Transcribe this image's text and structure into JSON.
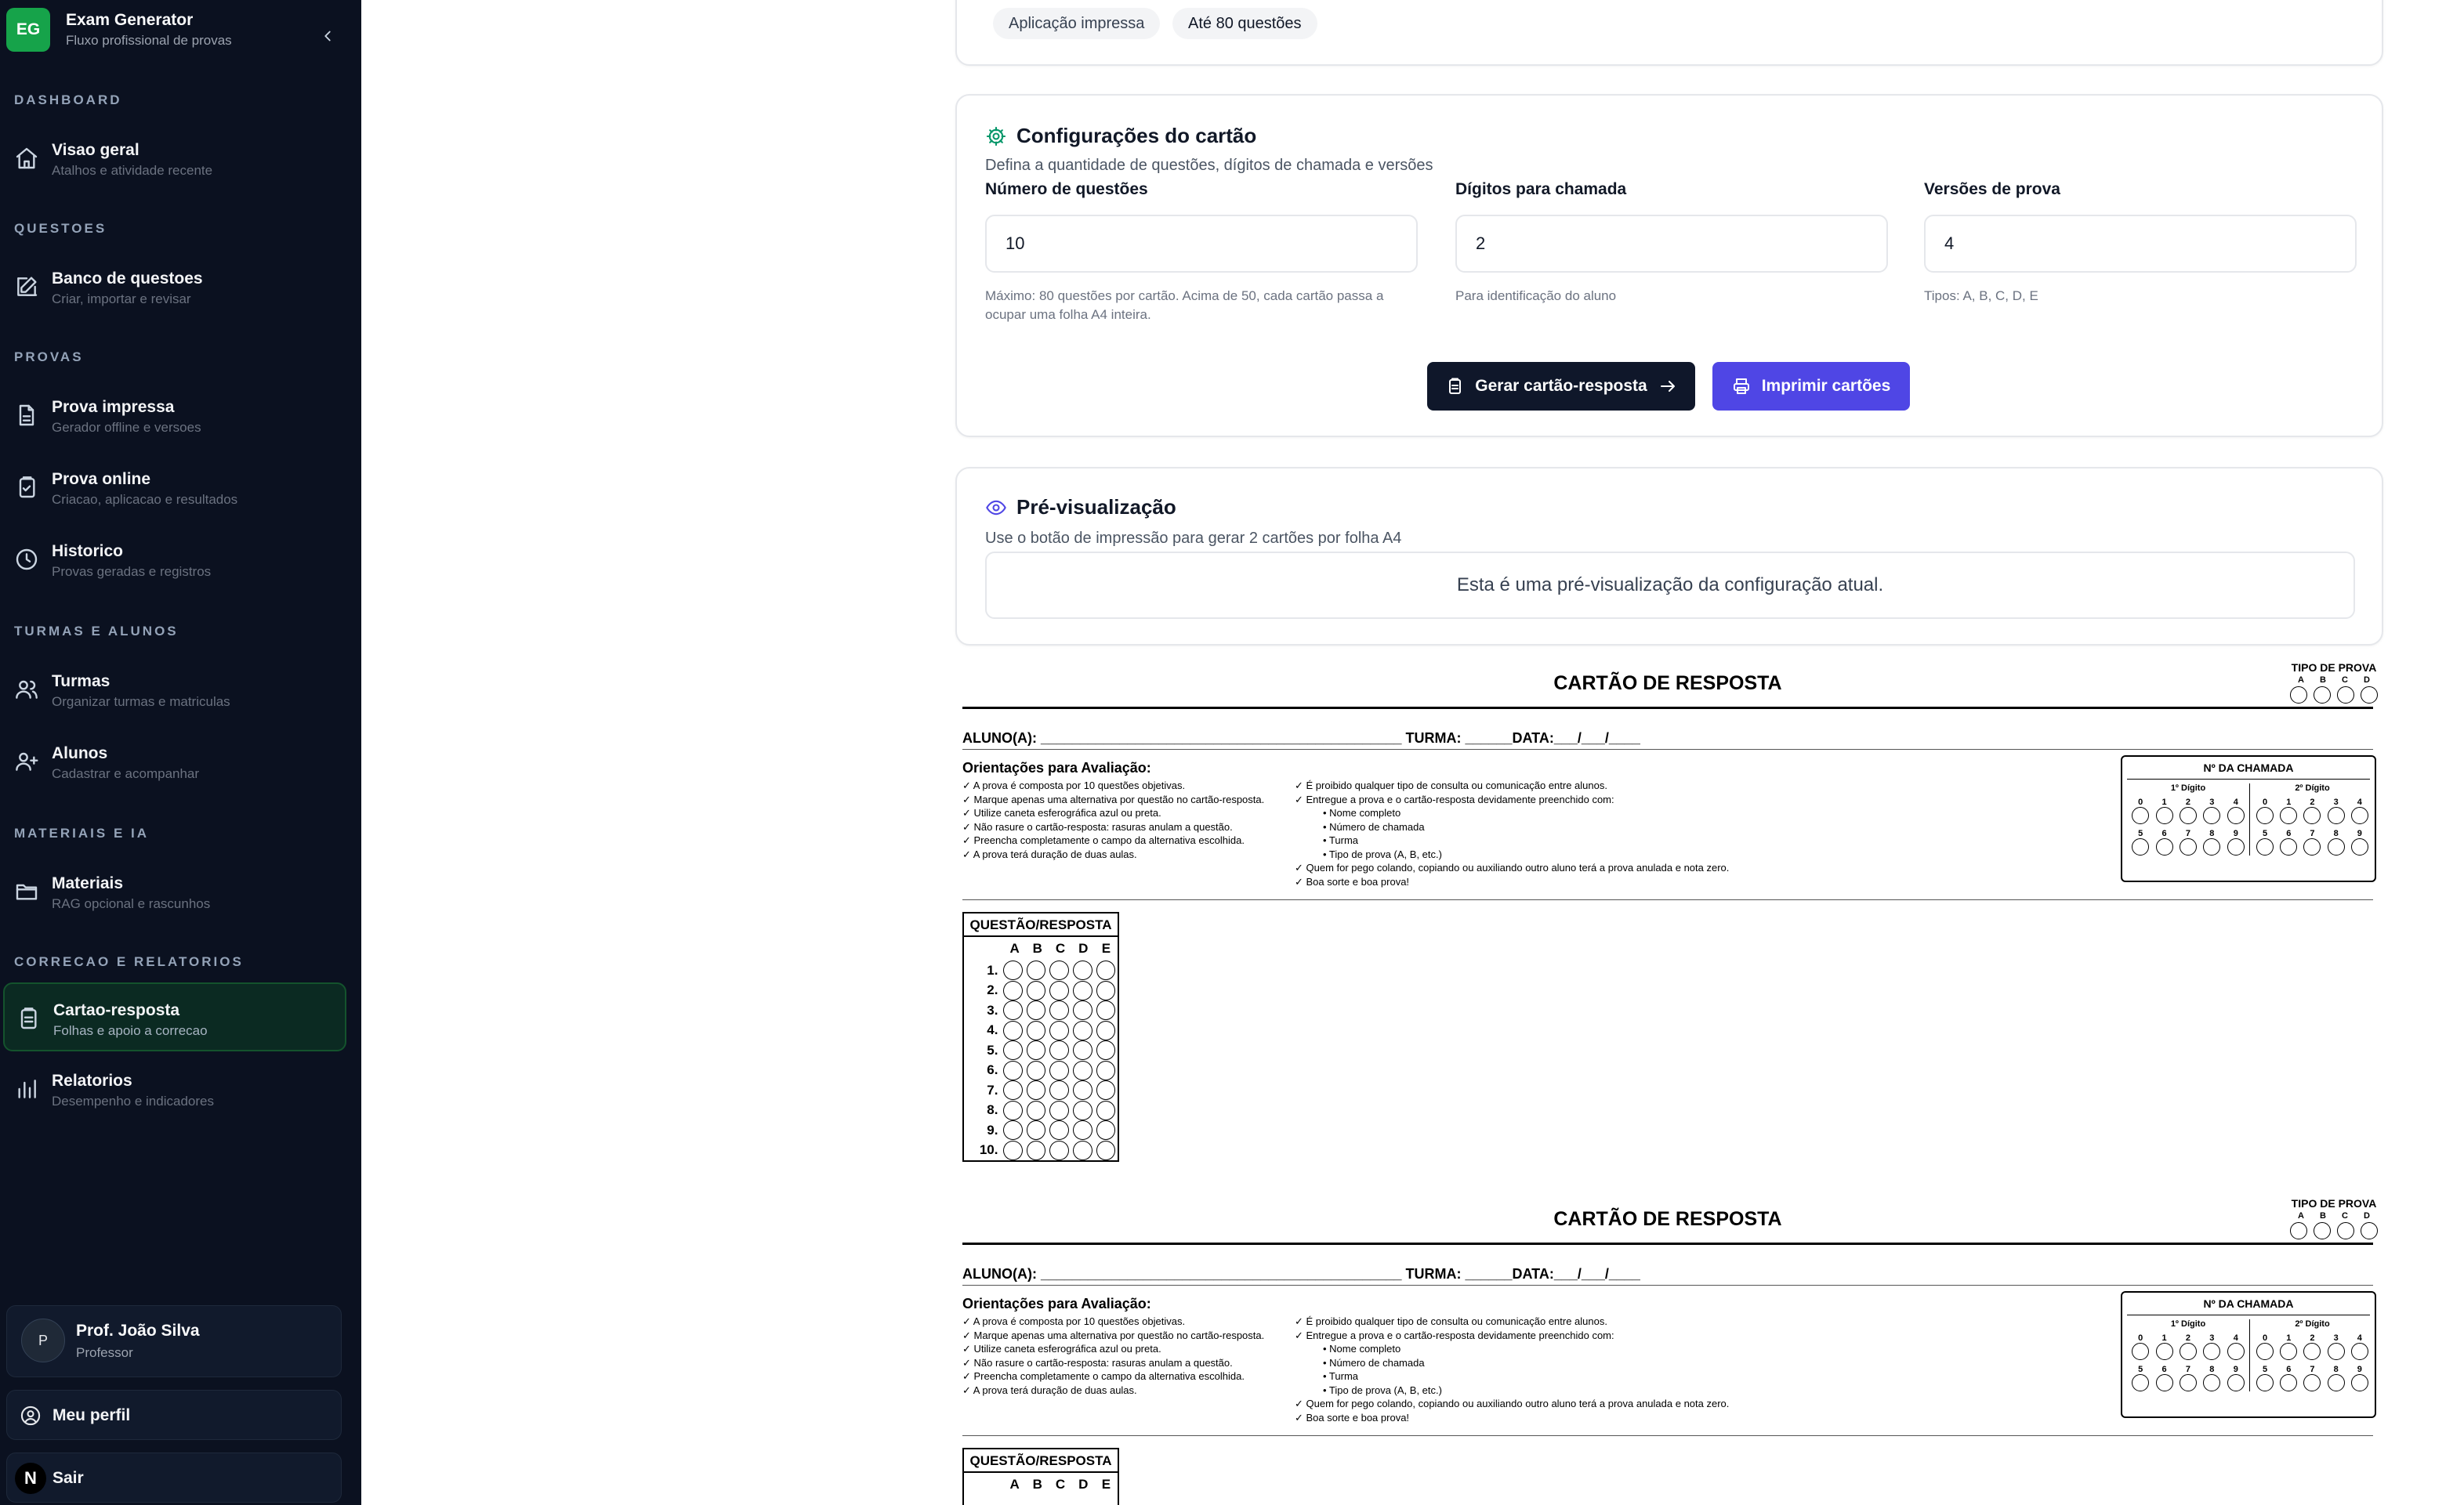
{
  "brand": {
    "initials": "EG",
    "title": "Exam Generator",
    "subtitle": "Fluxo profissional de provas"
  },
  "sidebar": {
    "sections": [
      "DASHBOARD",
      "QUESTOES",
      "PROVAS",
      "TURMAS E ALUNOS",
      "MATERIAIS E IA",
      "CORRECAO E RELATORIOS"
    ],
    "items": [
      {
        "label": "Visao geral",
        "sub": "Atalhos e atividade recente",
        "icon": "home-icon"
      },
      {
        "label": "Banco de questoes",
        "sub": "Criar, importar e revisar",
        "icon": "edit-icon"
      },
      {
        "label": "Prova impressa",
        "sub": "Gerador offline e versoes",
        "icon": "file-icon"
      },
      {
        "label": "Prova online",
        "sub": "Criacao, aplicacao e resultados",
        "icon": "clipboard-icon"
      },
      {
        "label": "Historico",
        "sub": "Provas geradas e registros",
        "icon": "clock-icon"
      },
      {
        "label": "Turmas",
        "sub": "Organizar turmas e matriculas",
        "icon": "users-icon"
      },
      {
        "label": "Alunos",
        "sub": "Cadastrar e acompanhar",
        "icon": "user-icon"
      },
      {
        "label": "Materiais",
        "sub": "RAG opcional e rascunhos",
        "icon": "folder-icon"
      },
      {
        "label": "Cartao-resposta",
        "sub": "Folhas e apoio a correcao",
        "icon": "clipboard-icon",
        "active": true
      },
      {
        "label": "Relatorios",
        "sub": "Desempenho e indicadores",
        "icon": "bar-chart-icon"
      }
    ],
    "user": {
      "initial": "P",
      "name": "Prof. João Silva",
      "role": "Professor"
    },
    "profile_label": "Meu perfil",
    "logout_label": "Sair",
    "logout_badge": "N"
  },
  "top_chips": [
    "Aplicação impressa",
    "Até 80 questões"
  ],
  "config": {
    "title": "Configurações do cartão",
    "description": "Defina a quantidade de questões, dígitos de chamada e versões",
    "fields": [
      {
        "label": "Número de questões",
        "value": "10",
        "hint": "Máximo: 80 questões por cartão. Acima de 50, cada cartão passa a ocupar uma folha A4 inteira."
      },
      {
        "label": "Dígitos para chamada",
        "value": "2",
        "hint": "Para identificação do aluno"
      },
      {
        "label": "Versões de prova",
        "value": "4",
        "hint": "Tipos: A, B, C, D, E"
      }
    ],
    "generate_label": "Gerar cartão-resposta",
    "print_label": "Imprimir cartões"
  },
  "preview": {
    "title": "Pré-visualização",
    "description": "Use o botão de impressão para gerar 2 cartões por folha A4",
    "note": "Esta é uma pré-visualização da configuração atual."
  },
  "sheet": {
    "title": "CARTÃO DE RESPOSTA",
    "tipo_title": "TIPO DE PROVA",
    "tipo_letters": [
      "A",
      "B",
      "C",
      "D"
    ],
    "aluno_line": "ALUNO(A): ______________________________________________ TURMA: ______DATA:___/___/____",
    "orient_title": "Orientações para Avaliação:",
    "orient_left": [
      "✓ A prova é composta por 10 questões objetivas.",
      "✓ Marque apenas uma alternativa por questão no cartão-resposta.",
      "✓ Utilize caneta esferográfica azul ou preta.",
      "✓ Não rasure o cartão-resposta: rasuras anulam a questão.",
      "✓ Preencha completamente o campo da alternativa escolhida.",
      "✓ A prova terá duração de duas aulas."
    ],
    "orient_right": [
      "✓ É proibido qualquer tipo de consulta ou comunicação entre alunos.",
      "✓ Entregue a prova e o cartão-resposta devidamente preenchido com:",
      "• Nome completo",
      "• Número de chamada",
      "• Turma",
      "• Tipo de prova (A, B, etc.)",
      "✓ Quem for pego colando, copiando ou auxiliando outro aluno terá a prova anulada e nota zero.",
      "✓ Boa sorte e boa prova!"
    ],
    "chamada_title": "Nº DA CHAMADA",
    "digit_titles": [
      "1º Dígito",
      "2º Dígito"
    ],
    "digits_row1": [
      "0",
      "1",
      "2",
      "3",
      "4"
    ],
    "digits_row2": [
      "5",
      "6",
      "7",
      "8",
      "9"
    ],
    "qr_title": "QUESTÃO/RESPOSTA",
    "qr_letters": [
      "A",
      "B",
      "C",
      "D",
      "E"
    ],
    "question_numbers": [
      "1.",
      "2.",
      "3.",
      "4.",
      "5.",
      "6.",
      "7.",
      "8.",
      "9.",
      "10."
    ]
  }
}
